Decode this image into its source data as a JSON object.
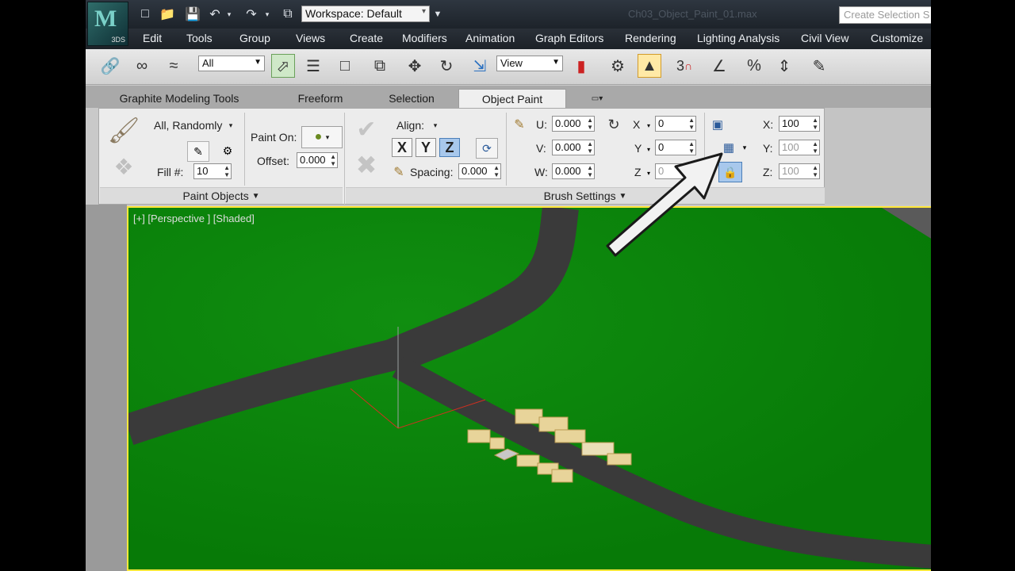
{
  "title_bar": {
    "logo_label": "3DS",
    "workspace_value": "Workspace: Default",
    "file_title": "Ch03_Object_Paint_01.max"
  },
  "menu": [
    "Edit",
    "Tools",
    "Group",
    "Views",
    "Create",
    "Modifiers",
    "Animation",
    "Graph Editors",
    "Rendering",
    "Lighting Analysis",
    "Civil View",
    "Customize"
  ],
  "toolbar": {
    "selection_filter": "All",
    "ref_coord": "View",
    "snap_3": "3",
    "search_placeholder": "Create Selection S"
  },
  "ribbon_tabs": [
    "Graphite Modeling Tools",
    "Freeform",
    "Selection",
    "Object Paint"
  ],
  "active_tab": "Object Paint",
  "paint_objects": {
    "object_mode": "All, Randomly",
    "fill_label": "Fill #:",
    "fill_value": "10",
    "paint_on_label": "Paint On:",
    "offset_label": "Offset:",
    "offset_value": "0.000",
    "footer": "Paint Objects"
  },
  "brush_settings": {
    "align_label": "Align:",
    "axis_x": "X",
    "axis_y": "Y",
    "axis_z": "Z",
    "spacing_label": "Spacing:",
    "spacing_value": "0.000",
    "u_label": "U:",
    "u_value": "0.000",
    "v_label": "V:",
    "v_value": "0.000",
    "w_label": "W:",
    "w_value": "0.000",
    "rx_label": "X",
    "rx_value": "0",
    "ry_label": "Y",
    "ry_value": "0",
    "rz_label": "Z",
    "rz_value": "0",
    "sx_label": "X:",
    "sx_value": "100",
    "sy_label": "Y:",
    "sy_value": "100",
    "sz_label": "Z:",
    "sz_value": "100",
    "footer": "Brush Settings"
  },
  "viewport": {
    "label": "[+] [Perspective ] [Shaded]"
  },
  "colors": {
    "grass": "#0c8a0c",
    "road": "#3a3a3a",
    "viewport_border": "#ffe83a",
    "title_bar": "#2a3038"
  }
}
